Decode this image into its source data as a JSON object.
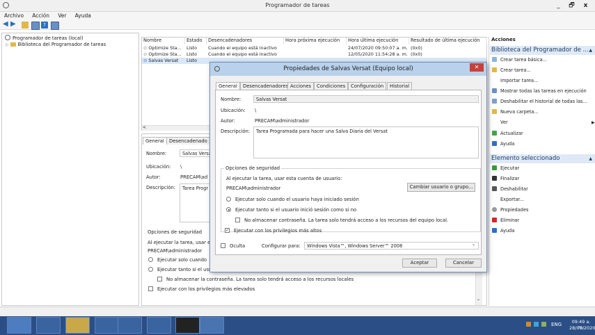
{
  "window": {
    "title": "Programador de tareas",
    "controls": [
      "_",
      "🗗",
      "x"
    ]
  },
  "menu": [
    "Archivo",
    "Acción",
    "Ver",
    "Ayuda"
  ],
  "tree": {
    "root": "Programador de tareas (local)",
    "child": "Biblioteca del Programador de tareas"
  },
  "list": {
    "columns": [
      "Nombre",
      "Estado",
      "Desencadenadores",
      "Hora próxima ejecución",
      "Hora última ejecución",
      "Resultado de última ejecución"
    ],
    "rows": [
      {
        "name": "Optimize Sta...",
        "status": "Listo",
        "trigger": "Cuando el equipo está inactivo",
        "next": "",
        "last": "24/07/2020 09:50:07 a. m.",
        "result": "(0x0)"
      },
      {
        "name": "Optimize Sta...",
        "status": "Listo",
        "trigger": "Cuando el equipo está inactivo",
        "next": "",
        "last": "12/05/2020 11:54:28 a. m.",
        "result": "(0x0)"
      },
      {
        "name": "Salvas Versat",
        "status": "Listo",
        "trigger": "",
        "next": "",
        "last": "",
        "result": ""
      }
    ]
  },
  "detail": {
    "tabs": [
      "General",
      "Desencadenado"
    ],
    "name_label": "Nombre:",
    "name_value": "Salvas Versa",
    "location_label": "Ubicación:",
    "location_value": "\\",
    "author_label": "Autor:",
    "author_value": "PRECAM\\ad",
    "desc_label": "Descripción:",
    "desc_value": "Tarea Progr",
    "security_title": "Opciones de seguridad",
    "security_line": "Al ejecutar la tarea, usar e",
    "security_user": "PRECAM\\administrador",
    "radio1": "Ejecutar solo cuando",
    "radio2": "Ejecutar tanto si el usu",
    "nostore": "No almacenar la contraseña. La tarea solo tendrá acceso a los recursos locales",
    "highest": "Ejecutar con los privilegios más elevados"
  },
  "dialog": {
    "title": "Propiedades de Salvas Versat (Equipo local)",
    "tabs": [
      "General",
      "Desencadenadores",
      "Acciones",
      "Condiciones",
      "Configuración",
      "Historial"
    ],
    "name_label": "Nombre:",
    "name_value": "Salvas Versat",
    "location_label": "Ubicación:",
    "location_value": "\\",
    "author_label": "Autor:",
    "author_value": "PRECAM\\administrador",
    "desc_label": "Descripción:",
    "desc_value": "Tarea Programada para hacer una Salva Diaria del Versat",
    "security_title": "Opciones de seguridad",
    "security_line": "Al ejecutar la tarea, usar esta cuenta de usuario:",
    "security_user": "PRECAM\\administrador",
    "change_user_button": "Cambiar usuario o grupo...",
    "radio_logged": "Ejecutar solo cuando el usuario haya iniciado sesión",
    "radio_whether": "Ejecutar tanto si el usuario inició sesión como si no",
    "nostore": "No almacenar contraseña. La tarea solo tendrá acceso a los recursos del equipo local.",
    "highest": "Ejecutar con los privilegios más altos",
    "hidden": "Oculta",
    "configure_label": "Configurar para:",
    "configure_value": "Windows Vista™, Windows Server™ 2008",
    "ok_button": "Aceptar",
    "cancel_button": "Cancelar"
  },
  "actions": {
    "header": "Acciones",
    "section1": "Biblioteca del Programador de ...",
    "items1": [
      "Crear tarea básica...",
      "Crear tarea...",
      "Importar tarea...",
      "Mostrar todas las tareas en ejecución",
      "Deshabilitar el historial de todas las...",
      "Nueva carpeta...",
      "Ver",
      "Actualizar",
      "Ayuda"
    ],
    "section2": "Elemento seleccionado",
    "items2": [
      "Ejecutar",
      "Finalizar",
      "Deshabilitar",
      "Exportar...",
      "Propiedades",
      "Eliminar",
      "Ayuda"
    ]
  },
  "taskbar": {
    "lang": "ENG",
    "time": "09:49 a. m.",
    "date": "28/09/2020"
  },
  "colors": {
    "taskbar": "#2a4e85",
    "dialog_title": "#b9d1ea",
    "section_bg": "#dfe9f5",
    "close_red": "#c7413a"
  }
}
